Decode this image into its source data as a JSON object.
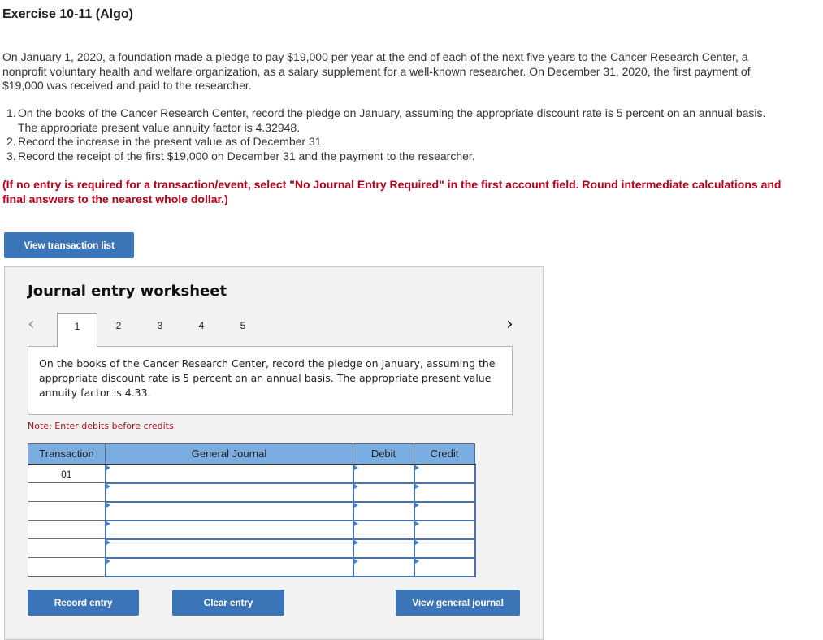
{
  "title": "Exercise 10-11 (Algo)",
  "intro": "On January 1, 2020, a foundation made a pledge to pay $19,000 per year at the end of each of the next five years to the Cancer Research Center, a nonprofit voluntary health and welfare organization, as a salary supplement for a well-known researcher. On December 31, 2020, the first payment of $19,000 was received and paid to the researcher.",
  "requirements": [
    {
      "num": "1.",
      "text": "On the books of the Cancer Research Center, record the pledge on January, assuming the appropriate discount rate is 5 percent on an annual basis. The appropriate present value annuity factor is 4.32948."
    },
    {
      "num": "2.",
      "text": "Record the increase in the present value as of December 31."
    },
    {
      "num": "3.",
      "text": "Record the receipt of the first $19,000 on December 31 and the payment to the researcher."
    }
  ],
  "instructions": "(If no entry is required for a transaction/event, select \"No Journal Entry Required\" in the first account field. Round intermediate calculations and final answers to the nearest whole dollar.)",
  "view_transaction_list_label": "View transaction list",
  "worksheet": {
    "title": "Journal entry worksheet",
    "pager": {
      "prev_icon": "‹",
      "next_icon": "›",
      "pages": [
        "1",
        "2",
        "3",
        "4",
        "5"
      ],
      "active_page": 1
    },
    "prompt": "On the books of the Cancer Research Center, record the pledge on January, assuming the appropriate discount rate is 5 percent on an annual basis. The appropriate present value annuity factor is 4.33.",
    "note": "Note: Enter debits before credits.",
    "table": {
      "headers": [
        "Transaction",
        "General Journal",
        "Debit",
        "Credit"
      ],
      "rows": [
        {
          "transaction": "01",
          "account": "",
          "debit": "",
          "credit": ""
        },
        {
          "transaction": "",
          "account": "",
          "debit": "",
          "credit": ""
        },
        {
          "transaction": "",
          "account": "",
          "debit": "",
          "credit": ""
        },
        {
          "transaction": "",
          "account": "",
          "debit": "",
          "credit": ""
        },
        {
          "transaction": "",
          "account": "",
          "debit": "",
          "credit": ""
        },
        {
          "transaction": "",
          "account": "",
          "debit": "",
          "credit": ""
        }
      ]
    },
    "buttons": {
      "record": "Record entry",
      "clear": "Clear entry",
      "view_general_journal": "View general journal"
    }
  },
  "colors": {
    "button_blue": "#3b75b7",
    "instructions_red": "#b3001b",
    "header_blue": "#7aaee3",
    "panel_bg": "#f2f2f2"
  }
}
